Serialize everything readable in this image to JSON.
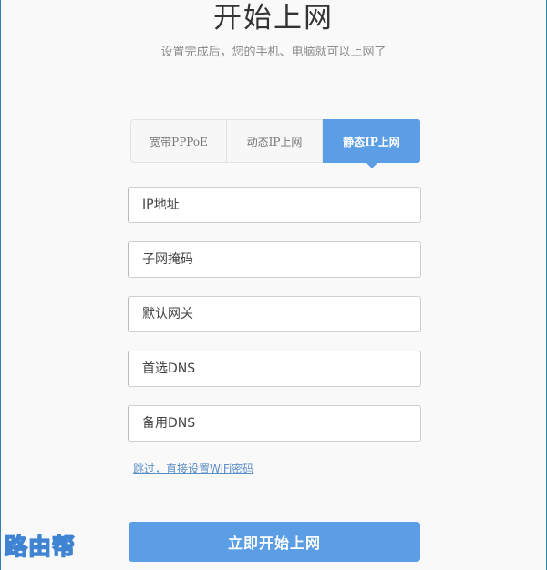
{
  "header": {
    "title": "开始上网",
    "subtitle": "设置完成后，您的手机、电脑就可以上网了"
  },
  "tabs": [
    {
      "label": "宽带PPPoE",
      "active": false
    },
    {
      "label": "动态IP上网",
      "active": false
    },
    {
      "label": "静态IP上网",
      "active": true
    }
  ],
  "form": {
    "ip_placeholder": "IP地址",
    "mask_placeholder": "子网掩码",
    "gateway_placeholder": "默认网关",
    "dns1_placeholder": "首选DNS",
    "dns2_placeholder": "备用DNS"
  },
  "skip_link": "跳过，直接设置WiFi密码",
  "submit_label": "立即开始上网",
  "watermark": "路由帮",
  "colors": {
    "accent": "#5b9ee6",
    "link": "#5b8fc7",
    "background": "#f9f9f9"
  }
}
